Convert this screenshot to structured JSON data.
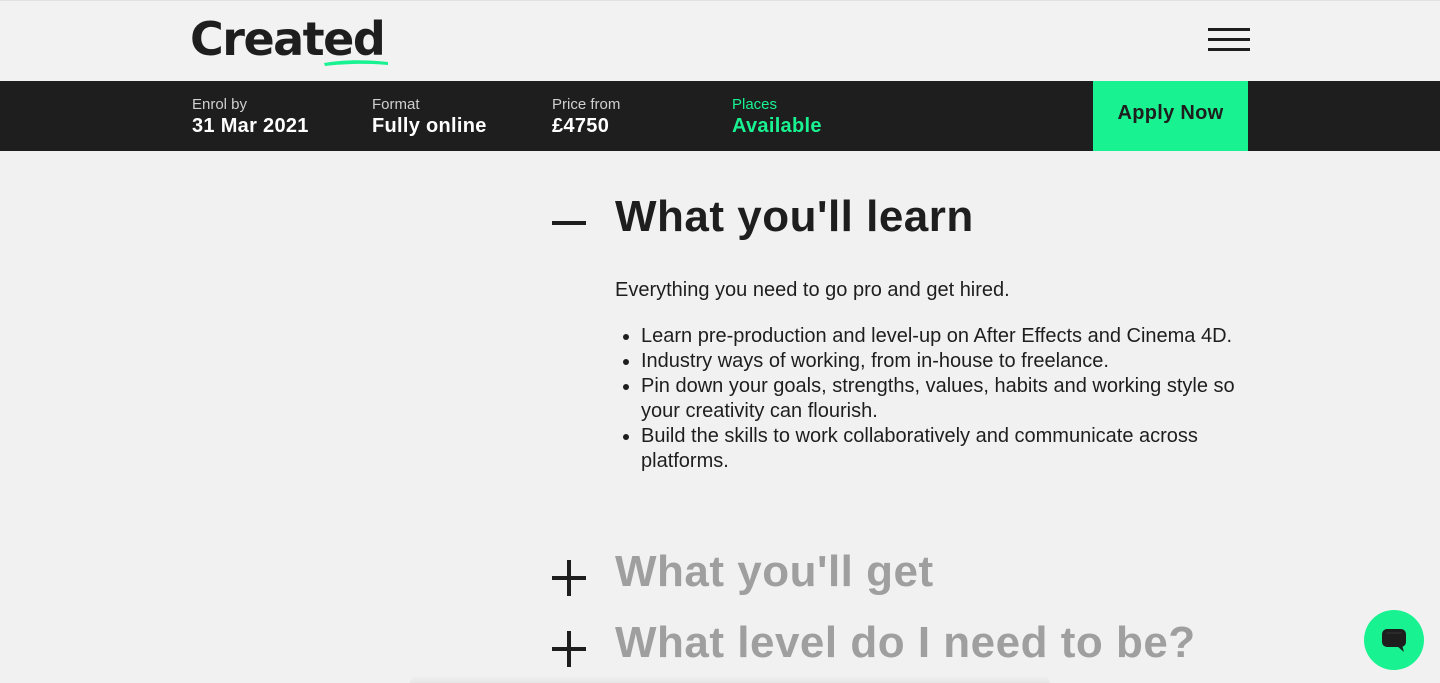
{
  "brand": {
    "logo_text": "Created",
    "accent_color": "#19f291",
    "dark_color": "#1e1e1e"
  },
  "infobar": {
    "enrol": {
      "label": "Enrol by",
      "value": "31 Mar 2021"
    },
    "format": {
      "label": "Format",
      "value": "Fully online"
    },
    "price": {
      "label": "Price from",
      "value": "£4750"
    },
    "places": {
      "label": "Places",
      "value": "Available"
    },
    "apply_label": "Apply Now"
  },
  "accordion": {
    "learn": {
      "title": "What you'll learn",
      "state": "expanded",
      "intro": "Everything you need to go pro and get hired.",
      "bullets": [
        "Learn pre-production and level-up on After Effects and Cinema 4D.",
        "Industry ways of working, from in-house to freelance.",
        "Pin down your goals, strengths, values, habits and working style so your creativity can flourish.",
        "Build the skills to work collaboratively and communicate across platforms."
      ]
    },
    "get": {
      "title": "What you'll get",
      "state": "collapsed"
    },
    "level": {
      "title": "What level do I need to be?",
      "state": "collapsed"
    }
  },
  "icons": {
    "menu": "hamburger-menu-icon",
    "collapse": "minus-icon",
    "expand": "plus-icon",
    "chat": "chat-bubble-icon"
  }
}
